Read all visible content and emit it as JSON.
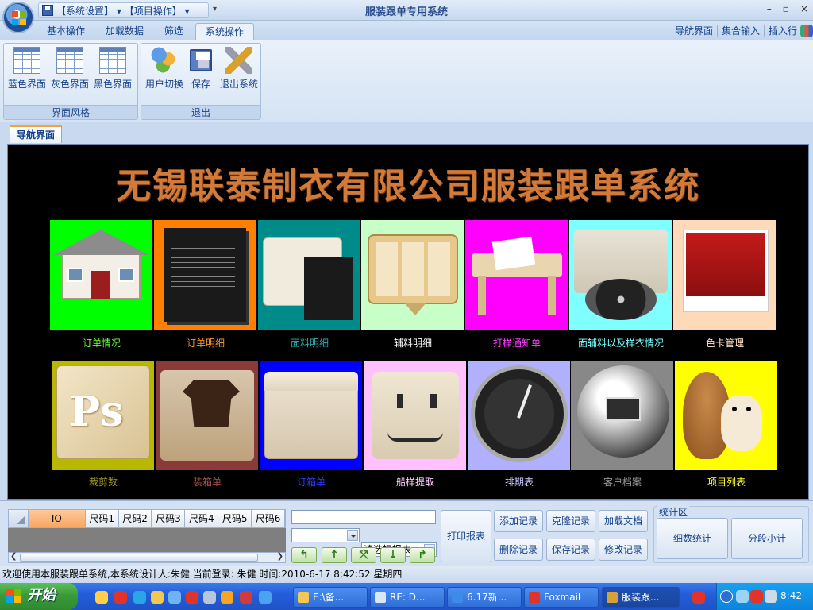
{
  "window": {
    "title": "服装跟单专用系统",
    "qat_menu1": "【系统设置】 ▾",
    "qat_menu2": "【项目操作】 ▾",
    "qat_dropdown": "▾",
    "controls": [
      "–",
      "▫",
      "×"
    ]
  },
  "ribbon_tabs": [
    {
      "label": "基本操作",
      "active": false
    },
    {
      "label": "加载数据",
      "active": false
    },
    {
      "label": "筛选",
      "active": false
    },
    {
      "label": "系统操作",
      "active": true
    }
  ],
  "right_nav": [
    "导航界面",
    "集合输入",
    "插入行"
  ],
  "ribbon": {
    "group1": {
      "label": "界面风格",
      "buttons": [
        "蓝色界面",
        "灰色界面",
        "黑色界面"
      ]
    },
    "group2": {
      "label": "退出",
      "buttons": [
        "用户切换",
        "保存",
        "退出系统"
      ]
    }
  },
  "doc_tab": "导航界面",
  "main": {
    "banner": "无锡联泰制衣有限公司服装跟单系统",
    "tiles": [
      {
        "label": "订单情况",
        "bg": "#00ff00",
        "label_color": "#6dff3a",
        "icon": "house-icon"
      },
      {
        "label": "订单明细",
        "bg": "#ff7f00",
        "label_color": "#ff9a2e",
        "icon": "document-icon"
      },
      {
        "label": "面料明细",
        "bg": "#008b8b",
        "label_color": "#2fb0b0",
        "icon": "folder-icon"
      },
      {
        "label": "辅料明细",
        "bg": "#c8ffc8",
        "label_color": "#ffffff",
        "icon": "finder-grid-icon"
      },
      {
        "label": "打样通知单",
        "bg": "#ff00ff",
        "label_color": "#ff40ff",
        "icon": "table-icon"
      },
      {
        "label": "面辅料以及样衣情况",
        "bg": "#7fffff",
        "label_color": "#7fffff",
        "icon": "disc-drive-icon"
      },
      {
        "label": "色卡管理",
        "bg": "#ffdab9",
        "label_color": "#ffe6cc",
        "icon": "red-card-icon"
      },
      {
        "label": "裁剪数",
        "bg": "#b8b800",
        "label_color": "#9a9a20",
        "icon": "photoshop-icon"
      },
      {
        "label": "装箱单",
        "bg": "#8b3a3a",
        "label_color": "#a0524d",
        "icon": "box-shirt-icon"
      },
      {
        "label": "订箱单",
        "bg": "#0000ff",
        "label_color": "#2a3aff",
        "icon": "box-icon"
      },
      {
        "label": "船样提取",
        "bg": "#ffc0ff",
        "label_color": "#ffd0ff",
        "icon": "finder-face-icon"
      },
      {
        "label": "排期表",
        "bg": "#b0b0ff",
        "label_color": "#c8c8ff",
        "icon": "dashboard-icon"
      },
      {
        "label": "客户档案",
        "bg": "#888888",
        "label_color": "#999999",
        "icon": "network-globe-icon"
      },
      {
        "label": "项目列表",
        "bg": "#ffff00",
        "label_color": "#ffff30",
        "icon": "squirrel-icon"
      }
    ]
  },
  "grid": {
    "columns": [
      "IO",
      "尺码1",
      "尺码2",
      "尺码3",
      "尺码4",
      "尺码5",
      "尺码6"
    ]
  },
  "controls": {
    "text_input": "",
    "combo1": "",
    "combo2": "请选择报表",
    "print_button": "打印报表",
    "nav_arrows": [
      "↰",
      "↑",
      "⤧",
      "↓",
      "↱"
    ],
    "record_buttons": [
      "添加记录",
      "克隆记录",
      "加载文档",
      "删除记录",
      "保存记录",
      "修改记录"
    ],
    "stat_group_label": "统计区",
    "stat_buttons": [
      "细数统计",
      "分段小计"
    ]
  },
  "status_bar": "欢迎使用本服装跟单系统,本系统设计人:朱健    当前登录: 朱健  时间:2010-6-17 8:42:52   星期四",
  "taskbar": {
    "start": "开始",
    "tasks": [
      {
        "label": "E:\\备...",
        "color": "#f3c852"
      },
      {
        "label": "RE: D...",
        "color": "#d9e6f8"
      },
      {
        "label": "6.17新...",
        "color": "#3d8be8"
      },
      {
        "label": "Foxmail",
        "color": "#e0342b"
      },
      {
        "label": "服装跟...",
        "color": "#d4a23a"
      }
    ],
    "clock": "8:42"
  }
}
